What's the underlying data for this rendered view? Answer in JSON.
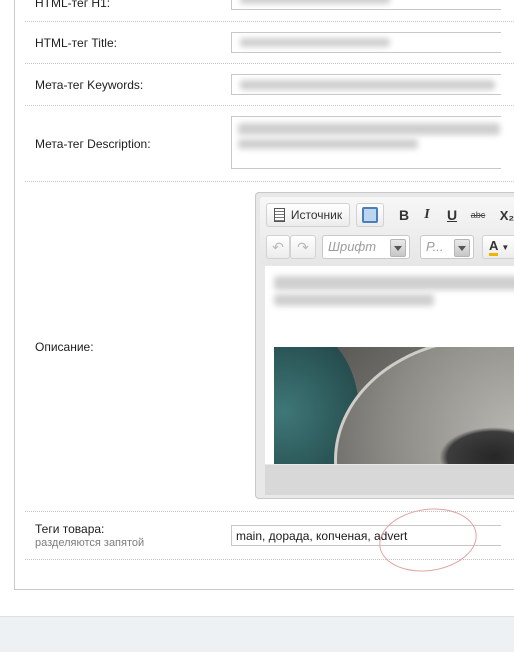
{
  "fields": {
    "h1_label": "HTML-тег H1:",
    "title_label": "HTML-тег Title:",
    "keywords_label": "Мета-тег Keywords:",
    "description_label": "Мета-тег Description:",
    "body_label": "Описание:",
    "tags_label": "Теги товара:",
    "tags_hint": "разделяются запятой",
    "tags_value": "main, дорада, копченая, advert"
  },
  "editor": {
    "source_label": "Источник",
    "bold": "B",
    "italic": "I",
    "underline": "U",
    "strike": "abc",
    "subscript": "X₂",
    "font_placeholder": "Шрифт",
    "size_placeholder": "Р...",
    "text_color": "A"
  },
  "icons": {
    "source": "document-icon",
    "maximize": "maximize-icon",
    "undo": "undo-icon",
    "redo": "redo-icon",
    "text_color": "text-color-icon"
  },
  "colors": {
    "accent_circle": "#e2a3a0",
    "panel_border": "#c9ccce"
  }
}
